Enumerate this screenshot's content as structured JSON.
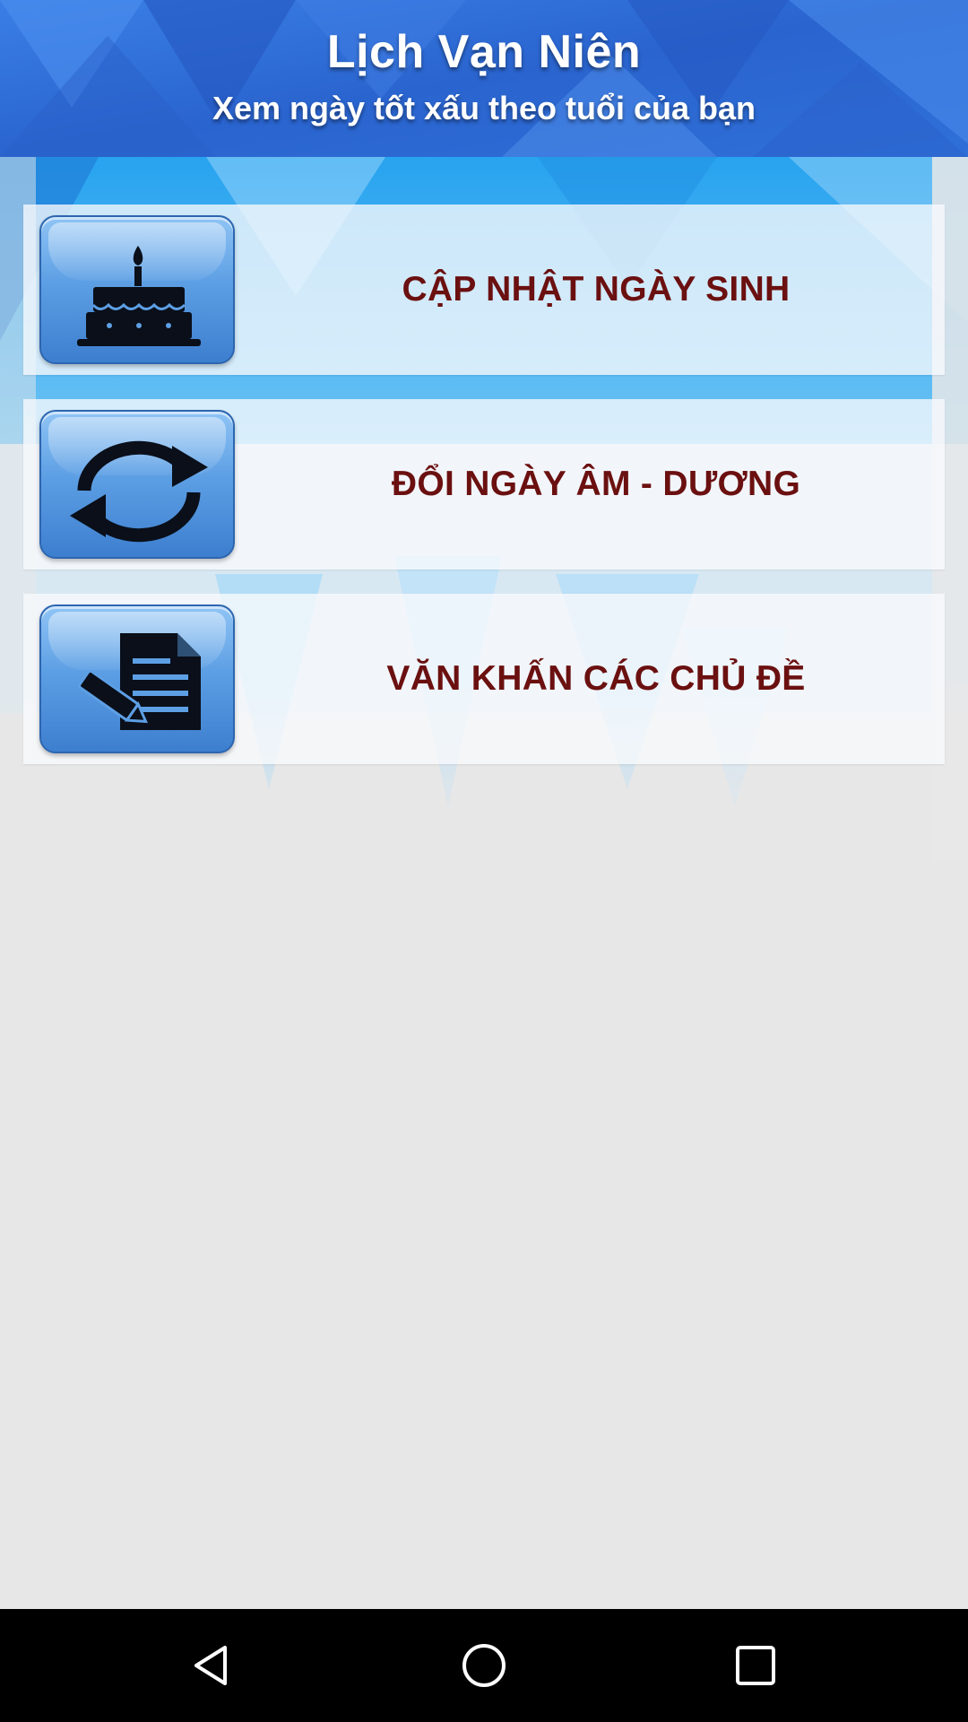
{
  "header": {
    "title": "Lịch Vạn Niên",
    "subtitle": "Xem ngày tốt xấu theo tuổi của bạn"
  },
  "menu": {
    "items": [
      {
        "label": "CẬP NHẬT NGÀY SINH",
        "icon": "birthday-cake-icon"
      },
      {
        "label": "ĐỔI NGÀY ÂM - DƯƠNG",
        "icon": "refresh-icon"
      },
      {
        "label": "VĂN KHẤN CÁC CHỦ ĐỀ",
        "icon": "document-edit-icon"
      }
    ]
  },
  "navbar": {
    "buttons": [
      "back",
      "home",
      "recents"
    ]
  },
  "colors": {
    "header_blue": "#2f6fd8",
    "label_text": "#6b1010",
    "tile_blue": "#5d9fe4",
    "background": "#e7e7e7",
    "navbar": "#000000"
  }
}
